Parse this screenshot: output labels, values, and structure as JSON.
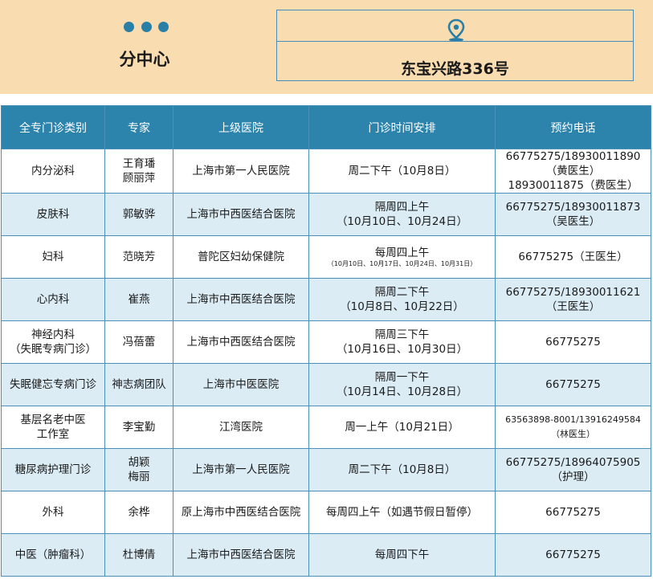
{
  "header": {
    "center_label": "分中心",
    "address": "东宝兴路336号",
    "icons": {
      "dots": "three-dots-icon",
      "location": "location-pin-icon"
    },
    "colors": {
      "band": "#f9dcb0",
      "accent": "#2a7fa6"
    }
  },
  "table": {
    "columns": [
      "全专门诊类别",
      "专家",
      "上级医院",
      "门诊时间安排",
      "预约电话"
    ],
    "rows": [
      {
        "category": [
          "内分泌科"
        ],
        "expert": [
          "王育璠",
          "顾丽萍"
        ],
        "hospital": "上海市第一人民医院",
        "schedule": [
          "周二下午（10月8日）"
        ],
        "phone": [
          "66775275/18930011890",
          "（黄医生）",
          "18930011875（费医生）"
        ]
      },
      {
        "category": [
          "皮肤科"
        ],
        "expert": [
          "郭敏骅"
        ],
        "hospital": "上海市中西医结合医院",
        "schedule": [
          "隔周四上午",
          "（10月10日、10月24日）"
        ],
        "phone": [
          "66775275/18930011873",
          "（吴医生）"
        ]
      },
      {
        "category": [
          "妇科"
        ],
        "expert": [
          "范晓芳"
        ],
        "hospital": "普陀区妇幼保健院",
        "schedule": [
          "每周四上午",
          "（10月10日、10月17日、10月24日、10月31日）"
        ],
        "phone": [
          "66775275（王医生）"
        ]
      },
      {
        "category": [
          "心内科"
        ],
        "expert": [
          "崔燕"
        ],
        "hospital": "上海市中西医结合医院",
        "schedule": [
          "隔周二下午",
          "（10月8日、10月22日）"
        ],
        "phone": [
          "66775275/18930011621",
          "（王医生）"
        ]
      },
      {
        "category": [
          "神经内科",
          "（失眠专病门诊）"
        ],
        "expert": [
          "冯蓓蕾"
        ],
        "hospital": "上海市中西医结合医院",
        "schedule": [
          "隔周三下午",
          "（10月16日、10月30日）"
        ],
        "phone": [
          "66775275"
        ]
      },
      {
        "category": [
          "失眠健忘专病门诊"
        ],
        "expert": [
          "神志病团队"
        ],
        "hospital": "上海市中医医院",
        "schedule": [
          "隔周一下午",
          "（10月14日、10月28日）"
        ],
        "phone": [
          "66775275"
        ]
      },
      {
        "category": [
          "基层名老中医",
          "工作室"
        ],
        "expert": [
          "李宝勤"
        ],
        "hospital": "江湾医院",
        "schedule": [
          "周一上午（10月21日）"
        ],
        "phone": [
          "63563898-8001/13916249584",
          "（林医生）"
        ]
      },
      {
        "category": [
          "糖尿病护理门诊"
        ],
        "expert": [
          "胡颖",
          "梅丽"
        ],
        "hospital": "上海市第一人民医院",
        "schedule": [
          "周二下午（10月8日）"
        ],
        "phone": [
          "66775275/18964075905",
          "（护理）"
        ]
      },
      {
        "category": [
          "外科"
        ],
        "expert": [
          "余桦"
        ],
        "hospital": "原上海市中西医结合医院",
        "schedule": [
          "每周四上午（如遇节假日暂停）"
        ],
        "phone": [
          "66775275"
        ]
      },
      {
        "category": [
          "中医（肿瘤科）"
        ],
        "expert": [
          "杜博倩"
        ],
        "hospital": "上海市中西医结合医院",
        "schedule": [
          "每周四下午"
        ],
        "phone": [
          "66775275"
        ]
      }
    ]
  }
}
